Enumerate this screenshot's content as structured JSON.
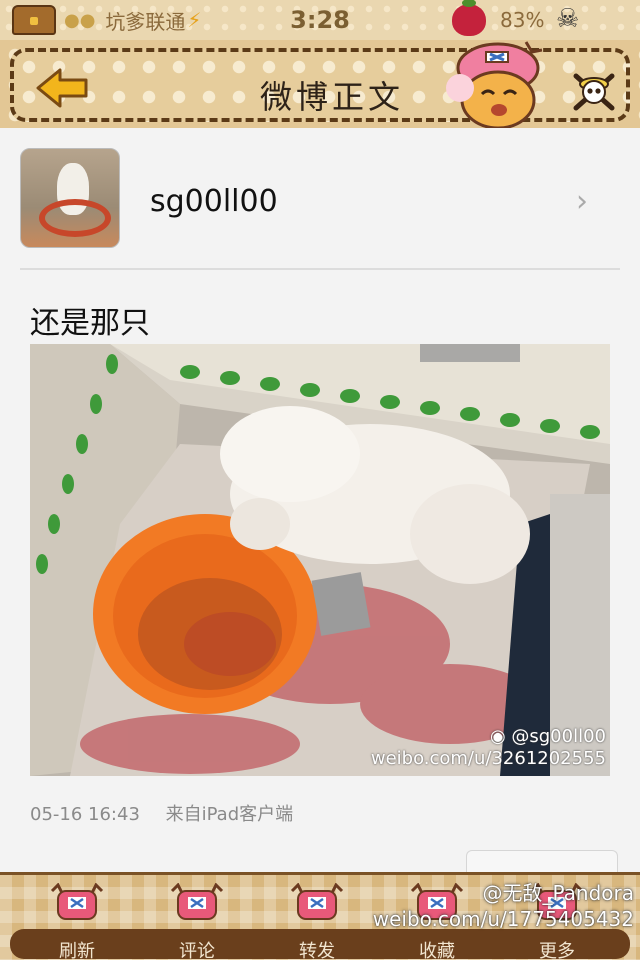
{
  "status_bar": {
    "carrier": "坑爹联通",
    "time": "3:28",
    "battery": "83%"
  },
  "nav": {
    "title": "微博正文"
  },
  "post": {
    "username": "sg00ll00",
    "text": "还是那只",
    "image_watermark": {
      "user": "@sg00ll00",
      "url": "weibo.com/u/3261202555"
    },
    "timestamp": "05-16 16:43",
    "source": "来自iPad客户端"
  },
  "tabbar": {
    "items": [
      {
        "label": "刷新"
      },
      {
        "label": "评论"
      },
      {
        "label": "转发"
      },
      {
        "label": "收藏"
      },
      {
        "label": "更多"
      }
    ]
  },
  "footer_watermark": {
    "user": "@无敌_Pandora",
    "url": "weibo.com/u/1775405432"
  },
  "colors": {
    "nav_bg": "#e3c795",
    "border_brown": "#5b3a17",
    "back_arrow": "#f2b51c",
    "tab_strip": "#6a3f1c",
    "hat_pink": "#e8597a"
  }
}
